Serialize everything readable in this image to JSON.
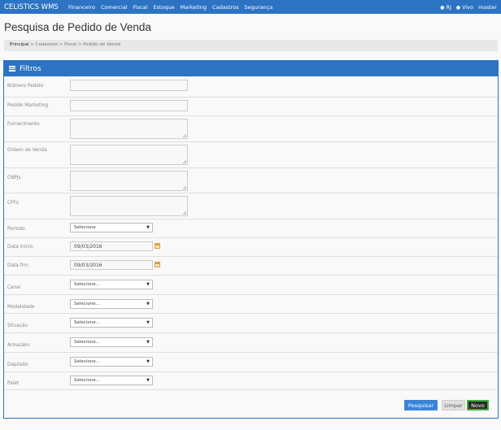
{
  "navbar": {
    "brand": "CELISTICS WMS",
    "menu": [
      "Financeiro",
      "Comercial",
      "Fiscal",
      "Estoque",
      "Marketing",
      "Cadastros",
      "Segurança"
    ],
    "location": "RJ",
    "status": "Vivo",
    "user": "master"
  },
  "page": {
    "title": "Pesquisa de Pedido de Venda",
    "breadcrumb": {
      "first": "Principal",
      "rest": " > Cadastros > Fiscal > Pedido de Venda"
    }
  },
  "filters": {
    "heading": "Filtros",
    "fields": {
      "numero_pedido": {
        "label": "Número Pedido",
        "value": ""
      },
      "pedido_marketing": {
        "label": "Pedido Marketing",
        "value": ""
      },
      "fornecimento": {
        "label": "Fornecimento",
        "value": ""
      },
      "ordem_venda": {
        "label": "Ordem de Venda",
        "value": ""
      },
      "cnpjs": {
        "label": "CNPJs",
        "value": ""
      },
      "cpfs": {
        "label": "CPFs",
        "value": ""
      },
      "periodo": {
        "label": "Período",
        "value": "Selecione"
      },
      "data_inicio": {
        "label": "Data início:",
        "value": "09/03/2016"
      },
      "data_fim": {
        "label": "Data fim:",
        "value": "09/03/2016"
      },
      "canal": {
        "label": "Canal",
        "value": "Selecione..."
      },
      "modalidade": {
        "label": "Modalidade",
        "value": "Selecione..."
      },
      "situacao": {
        "label": "Situação",
        "value": "Selecione..."
      },
      "armazem": {
        "label": "Armazém",
        "value": "Selecione..."
      },
      "deposito": {
        "label": "Depósito",
        "value": "Selecione..."
      },
      "palet": {
        "label": "Palet",
        "value": "Selecione..."
      }
    },
    "buttons": {
      "search": "Pesquisar",
      "clear": "Limpar",
      "new": "Novo"
    }
  },
  "colors": {
    "primary": "#2d73c4",
    "accent_new": "#3fb03f"
  }
}
